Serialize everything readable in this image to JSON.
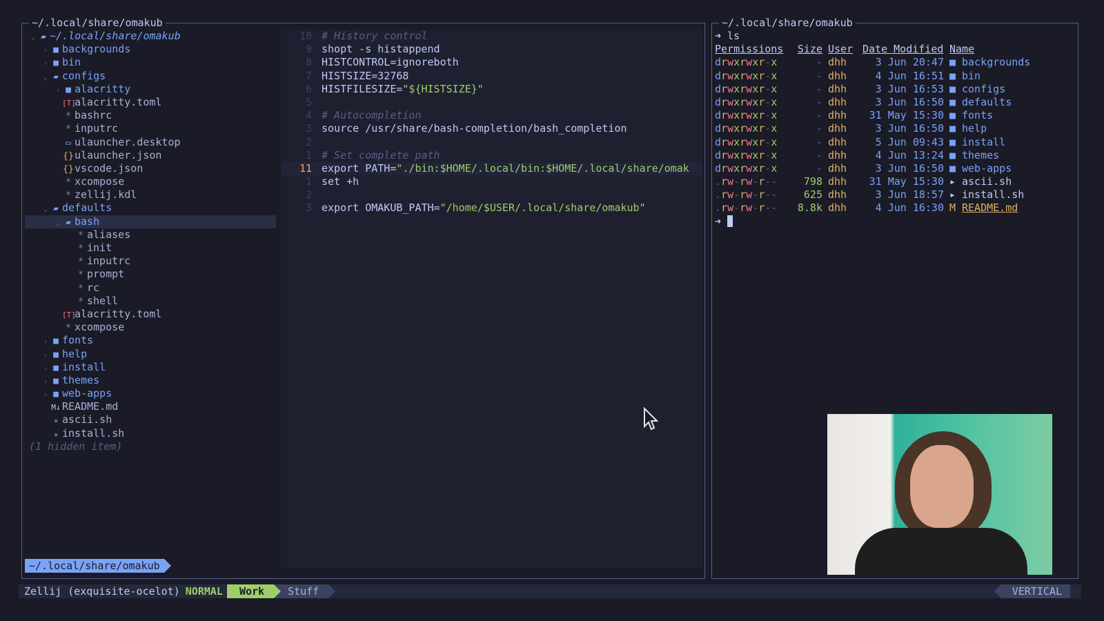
{
  "left_pane": {
    "title": "~/.local/share/omakub",
    "path_badge": "~/.local/share/omakub",
    "tree": [
      {
        "depth": 0,
        "chev": "open",
        "icon": "folder-open-icon",
        "label": "~/.local/share/omakub",
        "kind": "rootdir"
      },
      {
        "depth": 1,
        "chev": "closed",
        "icon": "folder-icon",
        "label": "backgrounds",
        "kind": "dir"
      },
      {
        "depth": 1,
        "chev": "closed",
        "icon": "folder-icon",
        "label": "bin",
        "kind": "dir"
      },
      {
        "depth": 1,
        "chev": "open",
        "icon": "folder-open-icon",
        "label": "configs",
        "kind": "dir"
      },
      {
        "depth": 2,
        "chev": "closed",
        "icon": "folder-icon",
        "label": "alacritty",
        "kind": "dir"
      },
      {
        "depth": 2,
        "chev": "",
        "icon": "toml-icon",
        "label": "alacritty.toml",
        "kind": "file"
      },
      {
        "depth": 2,
        "chev": "",
        "icon": "star-icon",
        "label": "bashrc",
        "kind": "file"
      },
      {
        "depth": 2,
        "chev": "",
        "icon": "star-icon",
        "label": "inputrc",
        "kind": "file"
      },
      {
        "depth": 2,
        "chev": "",
        "icon": "desktop-icon",
        "label": "ulauncher.desktop",
        "kind": "file"
      },
      {
        "depth": 2,
        "chev": "",
        "icon": "json-icon",
        "label": "ulauncher.json",
        "kind": "file"
      },
      {
        "depth": 2,
        "chev": "",
        "icon": "json-icon",
        "label": "vscode.json",
        "kind": "file"
      },
      {
        "depth": 2,
        "chev": "",
        "icon": "star-icon",
        "label": "xcompose",
        "kind": "file"
      },
      {
        "depth": 2,
        "chev": "",
        "icon": "star-icon",
        "label": "zellij.kdl",
        "kind": "file"
      },
      {
        "depth": 1,
        "chev": "open",
        "icon": "folder-open-icon",
        "label": "defaults",
        "kind": "dir"
      },
      {
        "depth": 2,
        "chev": "open",
        "icon": "folder-open-icon",
        "label": "bash",
        "kind": "dir",
        "selected": true
      },
      {
        "depth": 3,
        "chev": "",
        "icon": "star-icon",
        "label": "aliases",
        "kind": "file"
      },
      {
        "depth": 3,
        "chev": "",
        "icon": "star-icon",
        "label": "init",
        "kind": "file"
      },
      {
        "depth": 3,
        "chev": "",
        "icon": "star-icon",
        "label": "inputrc",
        "kind": "file"
      },
      {
        "depth": 3,
        "chev": "",
        "icon": "star-icon",
        "label": "prompt",
        "kind": "file"
      },
      {
        "depth": 3,
        "chev": "",
        "icon": "star-icon",
        "label": "rc",
        "kind": "file"
      },
      {
        "depth": 3,
        "chev": "",
        "icon": "star-icon",
        "label": "shell",
        "kind": "file"
      },
      {
        "depth": 2,
        "chev": "",
        "icon": "toml-icon",
        "label": "alacritty.toml",
        "kind": "file"
      },
      {
        "depth": 2,
        "chev": "",
        "icon": "star-icon",
        "label": "xcompose",
        "kind": "file"
      },
      {
        "depth": 1,
        "chev": "closed",
        "icon": "folder-icon",
        "label": "fonts",
        "kind": "dir"
      },
      {
        "depth": 1,
        "chev": "closed",
        "icon": "folder-icon",
        "label": "help",
        "kind": "dir"
      },
      {
        "depth": 1,
        "chev": "closed",
        "icon": "folder-icon",
        "label": "install",
        "kind": "dir"
      },
      {
        "depth": 1,
        "chev": "closed",
        "icon": "folder-icon",
        "label": "themes",
        "kind": "dir"
      },
      {
        "depth": 1,
        "chev": "closed",
        "icon": "folder-icon",
        "label": "web-apps",
        "kind": "dir"
      },
      {
        "depth": 1,
        "chev": "",
        "icon": "markdown-icon",
        "label": "README.md",
        "kind": "file"
      },
      {
        "depth": 1,
        "chev": "",
        "icon": "shell-file-icon",
        "label": "ascii.sh",
        "kind": "file"
      },
      {
        "depth": 1,
        "chev": "",
        "icon": "shell-file-icon",
        "label": "install.sh",
        "kind": "file"
      },
      {
        "depth": 0,
        "chev": "",
        "icon": "",
        "label": "(1 hidden item)",
        "kind": "muted"
      }
    ]
  },
  "editor": {
    "lines": [
      {
        "num": "10",
        "parts": [
          {
            "t": "# History control",
            "c": "comment"
          }
        ]
      },
      {
        "num": "9",
        "parts": [
          {
            "t": "shopt -s histappend"
          }
        ]
      },
      {
        "num": "8",
        "parts": [
          {
            "t": "HISTCONTROL=ignoreboth"
          }
        ]
      },
      {
        "num": "7",
        "parts": [
          {
            "t": "HISTSIZE=32768"
          }
        ]
      },
      {
        "num": "6",
        "parts": [
          {
            "t": "HISTFILESIZE="
          },
          {
            "t": "\"${HISTSIZE}\"",
            "c": "str"
          }
        ]
      },
      {
        "num": "5",
        "parts": []
      },
      {
        "num": "4",
        "parts": [
          {
            "t": "# Autocompletion",
            "c": "comment"
          }
        ]
      },
      {
        "num": "3",
        "parts": [
          {
            "t": "source /usr/share/bash-completion/bash_completion"
          }
        ]
      },
      {
        "num": "2",
        "parts": []
      },
      {
        "num": "1",
        "parts": [
          {
            "t": "# Set complete path",
            "c": "comment"
          }
        ]
      },
      {
        "num": "11",
        "active": true,
        "parts": [
          {
            "t": "export PATH="
          },
          {
            "t": "\"./bin:$HOME/.local/bin:$HOME/.local/share/omak",
            "c": "str"
          }
        ]
      },
      {
        "num": "1",
        "parts": [
          {
            "t": "set +h"
          }
        ]
      },
      {
        "num": "2",
        "parts": []
      },
      {
        "num": "3",
        "parts": [
          {
            "t": "export OMAKUB_PATH="
          },
          {
            "t": "\"/home/$USER/.local/share/omakub\"",
            "c": "str"
          }
        ]
      }
    ]
  },
  "right_pane": {
    "title": "~/.local/share/omakub",
    "command": "ls",
    "headers": {
      "perm": "Permissions",
      "size": "Size",
      "user": "User",
      "date": "Date Modified",
      "name": "Name"
    },
    "entries": [
      {
        "perm": "drwxrwxr-x",
        "size": "-",
        "user": "dhh",
        "date": "3 Jun 20:47",
        "name": "backgrounds",
        "type": "dir"
      },
      {
        "perm": "drwxrwxr-x",
        "size": "-",
        "user": "dhh",
        "date": "4 Jun 16:51",
        "name": "bin",
        "type": "dir"
      },
      {
        "perm": "drwxrwxr-x",
        "size": "-",
        "user": "dhh",
        "date": "3 Jun 16:53",
        "name": "configs",
        "type": "dir"
      },
      {
        "perm": "drwxrwxr-x",
        "size": "-",
        "user": "dhh",
        "date": "3 Jun 16:50",
        "name": "defaults",
        "type": "dir"
      },
      {
        "perm": "drwxrwxr-x",
        "size": "-",
        "user": "dhh",
        "date": "31 May 15:30",
        "name": "fonts",
        "type": "dir"
      },
      {
        "perm": "drwxrwxr-x",
        "size": "-",
        "user": "dhh",
        "date": "3 Jun 16:50",
        "name": "help",
        "type": "dir"
      },
      {
        "perm": "drwxrwxr-x",
        "size": "-",
        "user": "dhh",
        "date": "5 Jun 09:43",
        "name": "install",
        "type": "dir"
      },
      {
        "perm": "drwxrwxr-x",
        "size": "-",
        "user": "dhh",
        "date": "4 Jun 13:24",
        "name": "themes",
        "type": "dir"
      },
      {
        "perm": "drwxrwxr-x",
        "size": "-",
        "user": "dhh",
        "date": "3 Jun 16:50",
        "name": "web-apps",
        "type": "dir"
      },
      {
        "perm": ".rw-rw-r--",
        "size": "798",
        "user": "dhh",
        "date": "31 May 15:30",
        "name": "ascii.sh",
        "type": "sh"
      },
      {
        "perm": ".rw-rw-r--",
        "size": "625",
        "user": "dhh",
        "date": "3 Jun 18:57",
        "name": "install.sh",
        "type": "sh"
      },
      {
        "perm": ".rw-rw-r--",
        "size": "8.8k",
        "user": "dhh",
        "date": "4 Jun 16:30",
        "name": "README.md",
        "type": "md"
      }
    ]
  },
  "status_bar": {
    "session": "Zellij (exquisite-ocelot)",
    "mode": "NORMAL",
    "tabs": [
      {
        "label": "Work",
        "active": true
      },
      {
        "label": "Stuff",
        "active": false
      }
    ],
    "layout": "VERTICAL"
  }
}
